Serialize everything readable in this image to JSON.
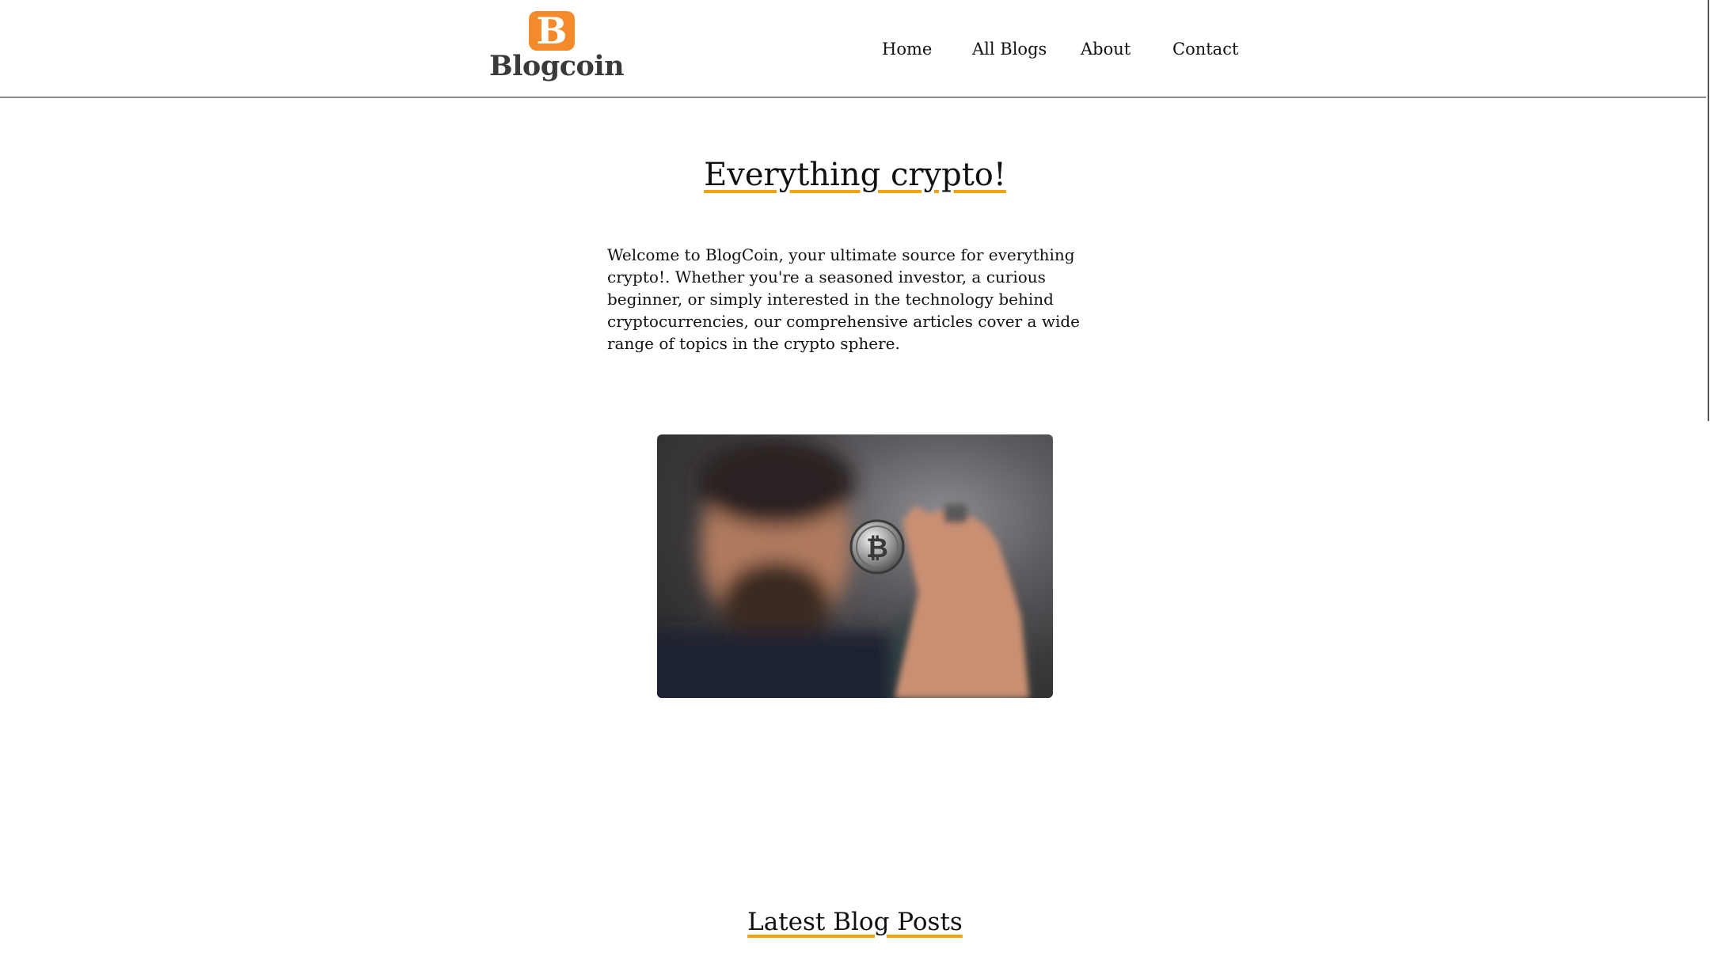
{
  "brand": {
    "logo_letter": "B",
    "name": "Blogcoin",
    "accent_color": "#f38a2b"
  },
  "nav": {
    "items": [
      {
        "label": "Home"
      },
      {
        "label": "All Blogs"
      },
      {
        "label": "About"
      },
      {
        "label": "Contact"
      }
    ]
  },
  "hero": {
    "title": "Everything crypto!",
    "underline_color": "#f4a10e",
    "intro": "Welcome to BlogCoin, your ultimate source for everything crypto!. Whether you're a seasoned investor, a curious beginner, or simply interested in the technology behind cryptocurrencies, our comprehensive articles cover a wide range of topics in the crypto sphere.",
    "image_icon": "bitcoin-coin-photo"
  },
  "latest": {
    "title": "Latest Blog Posts"
  }
}
